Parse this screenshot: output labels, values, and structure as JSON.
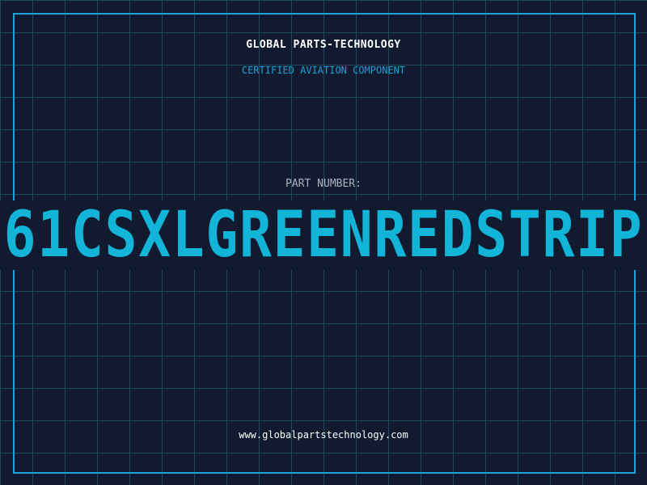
{
  "header": {
    "brand": "GLOBAL PARTS-TECHNOLOGY",
    "subtitle": "CERTIFIED AVIATION COMPONENT"
  },
  "part": {
    "label": "PART NUMBER:",
    "number": "61CSXLGREENREDSTRIP"
  },
  "footer": {
    "url": "www.globalpartstechnology.com"
  },
  "colors": {
    "background": "#111a2e",
    "grid": "#1f4a5e",
    "accent": "#1aa3d6",
    "part_number": "#12b4d8",
    "label": "#a9b4c2",
    "text": "#ffffff"
  }
}
